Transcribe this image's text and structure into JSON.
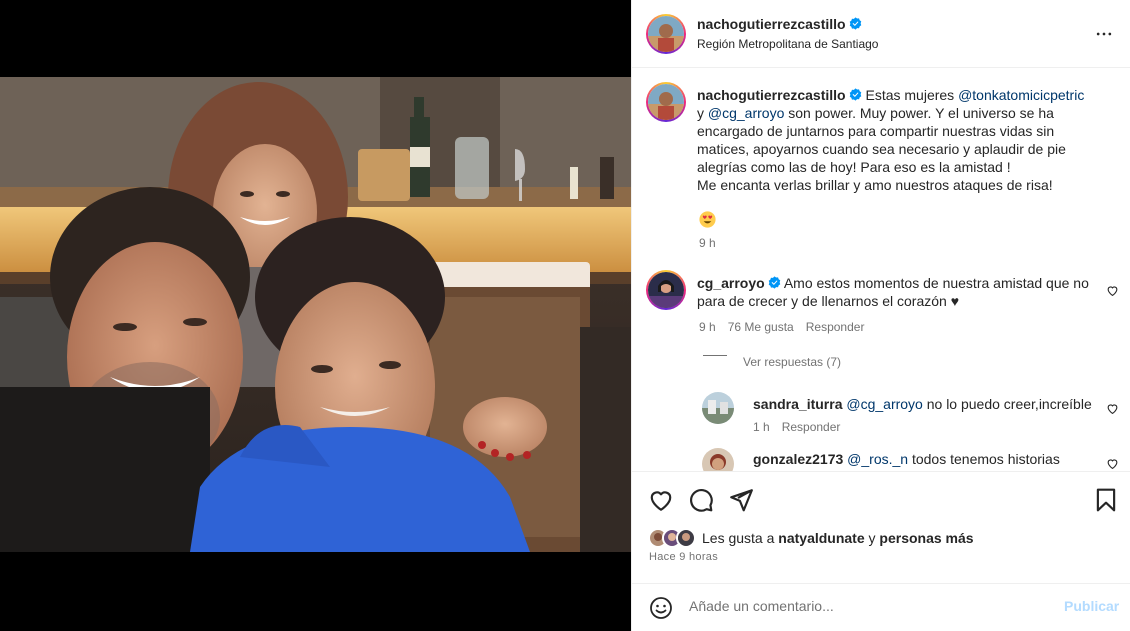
{
  "post": {
    "username": "nachogutierrezcastillo",
    "location": "Región Metropolitana de Santiago"
  },
  "caption": {
    "username": "nachogutierrezcastillo",
    "text_1": "Estas mujeres ",
    "mention_1": "@tonkatomicicpetric",
    "text_2": " y ",
    "mention_2": "@cg_arroyo",
    "text_3": " son power. Muy power. Y el universo se ha encargado de juntarnos para compartir nuestras vidas sin matices, apoyarnos cuando sea necesario y aplaudir de pie alegrías como las de hoy! Para eso es la amistad !",
    "text_4": "Me encanta verlas brillar y amo nuestros ataques de risa!",
    "emoji": "😍",
    "time": "9 h"
  },
  "comments": [
    {
      "username": "cg_arroyo",
      "text": "Amo estos momentos de nuestra amistad que no para de crecer y de llenarnos el corazón ♥",
      "time": "9 h",
      "likes": "76 Me gusta",
      "reply": "Responder",
      "view_replies": "Ver respuestas (7)"
    }
  ],
  "replies": [
    {
      "username": "sandra_iturra",
      "mention": "@cg_arroyo",
      "text": " no lo puedo creer,increíble",
      "time": "1 h",
      "reply": "Responder"
    },
    {
      "username": "gonzalez2173",
      "mention": "@_ros._n",
      "text": " todos tenemos historias"
    }
  ],
  "likes": {
    "prefix": "Les gusta a ",
    "user": "natyaldunate",
    "suffix": " y ",
    "others": "personas más"
  },
  "posted": "Hace 9 horas",
  "add_comment": {
    "placeholder": "Añade un comentario...",
    "publish": "Publicar"
  },
  "icons": {
    "verified": "verified-badge-icon",
    "more": "more-options-icon",
    "like": "heart-icon",
    "comment": "comment-icon",
    "share": "share-icon",
    "save": "bookmark-icon",
    "emoji": "emoji-icon"
  },
  "colors": {
    "mention": "#00376b",
    "verified": "#0095f6",
    "publish_disabled": "#b3dbff"
  }
}
